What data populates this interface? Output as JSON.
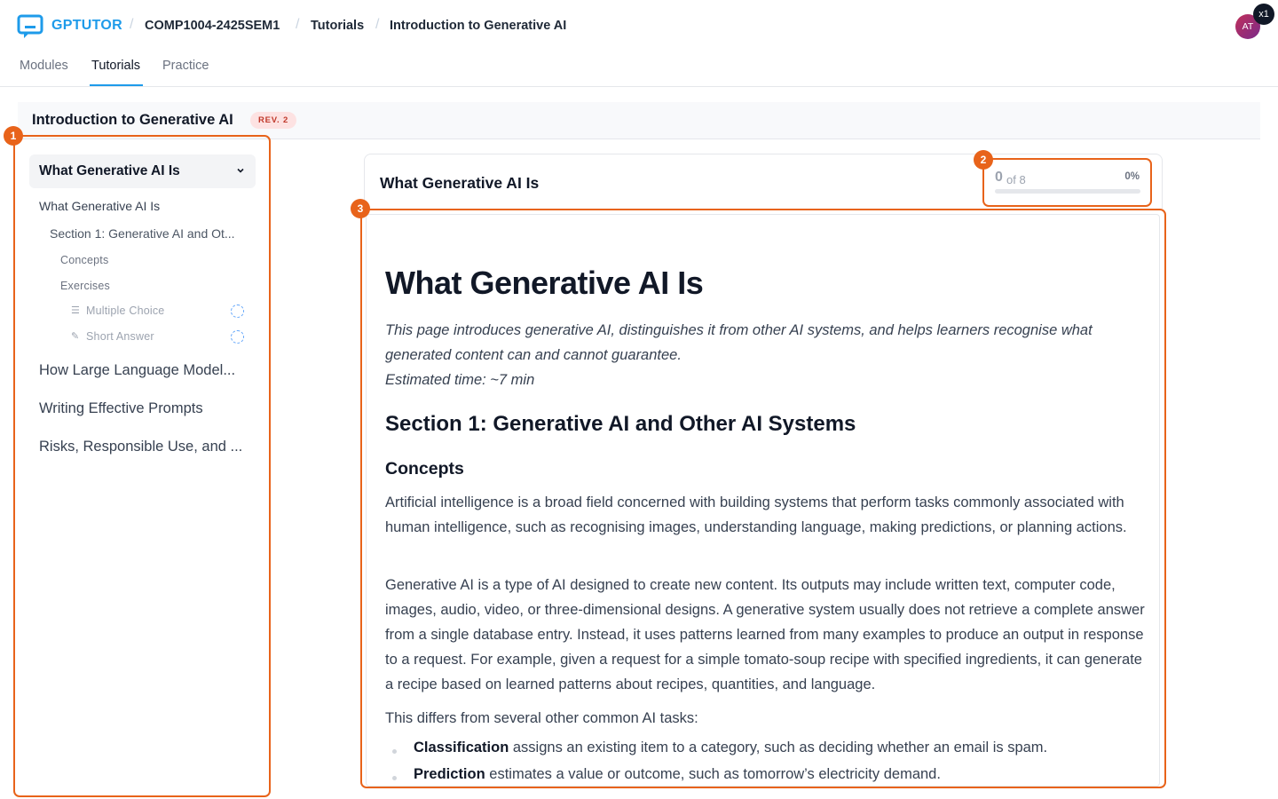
{
  "header": {
    "brand": "GPTUTOR",
    "breadcrumbs": [
      "COMP1004-2425SEM1",
      "Tutorials",
      "Introduction to Generative AI"
    ],
    "avatar_initials": "AT",
    "badge": "x1"
  },
  "tabs": [
    "Modules",
    "Tutorials",
    "Practice"
  ],
  "active_tab": "Tutorials",
  "page": {
    "title": "Introduction to Generative AI",
    "revision": "REV. 2"
  },
  "sidebar": {
    "expanded_title": "What Generative AI Is",
    "page_label": "What Generative AI Is",
    "section_label": "Section 1: Generative AI and Ot...",
    "concepts_label": "Concepts",
    "exercises_label": "Exercises",
    "exercises": [
      {
        "label": "Multiple Choice",
        "icon": "list-icon"
      },
      {
        "label": "Short Answer",
        "icon": "pencil-icon"
      }
    ],
    "other_pages": [
      "How Large Language Model...",
      "Writing Effective Prompts",
      "Risks, Responsible Use, and ..."
    ]
  },
  "progress": {
    "completed": "0",
    "of_total": "of 8",
    "percent_label": "0%",
    "fraction": 0
  },
  "content": {
    "header_title": "What Generative AI Is",
    "h1": "What Generative AI Is",
    "intro_line1": "This page introduces generative AI, distinguishes it from other AI systems, and helps learners recognise what generated content can and cannot guarantee.",
    "intro_line2": "Estimated time: ~7 min",
    "section_heading": "Section 1: Generative AI and Other AI Systems",
    "concepts_heading": "Concepts",
    "para1": "Artificial intelligence is a broad field concerned with building systems that perform tasks commonly associated with human intelligence, such as recognising images, understanding language, making predictions, or planning actions.",
    "para2": "Generative AI is a type of AI designed to create new content. Its outputs may include written text, computer code, images, audio, video, or three-dimensional designs. A generative system usually does not retrieve a complete answer from a single database entry. Instead, it uses patterns learned from many examples to produce an output in response to a request. For example, given a request for a simple tomato-soup recipe with specified ingredients, it can generate a recipe based on learned patterns about recipes, quantities, and language.",
    "para3": "This differs from several other common AI tasks:",
    "bullets": [
      {
        "term": "Classification",
        "text": " assigns an existing item to a category, such as deciding whether an email is spam."
      },
      {
        "term": "Prediction",
        "text": " estimates a value or outcome, such as tomorrow’s electricity demand."
      }
    ]
  },
  "markers": [
    "1",
    "2",
    "3"
  ],
  "colors": {
    "brand": "#1e9bea",
    "highlight": "#e8631a",
    "rev_badge_bg": "#fde2e2",
    "rev_badge_text": "#c0392b"
  }
}
